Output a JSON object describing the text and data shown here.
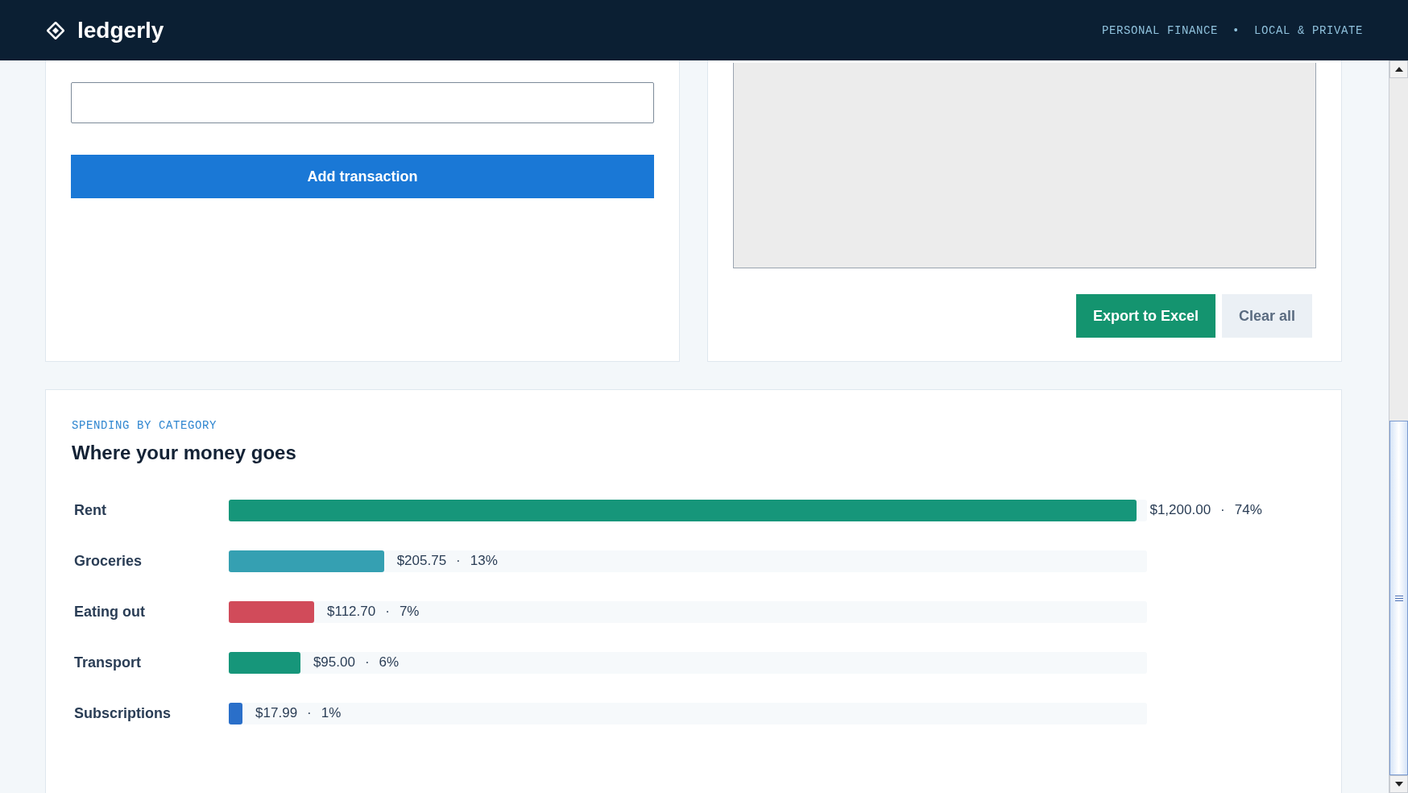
{
  "header": {
    "brand": "ledgerly",
    "tagline": "PERSONAL FINANCE  •  LOCAL & PRIVATE"
  },
  "entry_form": {
    "submit_button": "Add transaction"
  },
  "transactions_panel": {
    "buttons": [
      {
        "label": "Export to Excel",
        "kind": "primary"
      },
      {
        "label": "Clear all",
        "kind": "secondary"
      }
    ]
  },
  "spending": {
    "eyebrow": "SPENDING BY CATEGORY",
    "title": "Where your money goes",
    "categories": [
      {
        "name": "Rent",
        "amount": "$1,200.00",
        "separator": "·",
        "share": "74%",
        "level": 0.989,
        "color": "#16967a"
      },
      {
        "name": "Groceries",
        "amount": "$205.75",
        "separator": "·",
        "share": "13%",
        "level": 0.169,
        "color": "#35a0b2"
      },
      {
        "name": "Eating out",
        "amount": "$112.70",
        "separator": "·",
        "share": "7%",
        "level": 0.093,
        "color": "#d14b5a"
      },
      {
        "name": "Transport",
        "amount": "$95.00",
        "separator": "·",
        "share": "6%",
        "level": 0.078,
        "color": "#16967a"
      },
      {
        "name": "Subscriptions",
        "amount": "$17.99",
        "separator": "·",
        "share": "1%",
        "level": 0.015,
        "color": "#2a6fc9"
      }
    ]
  }
}
